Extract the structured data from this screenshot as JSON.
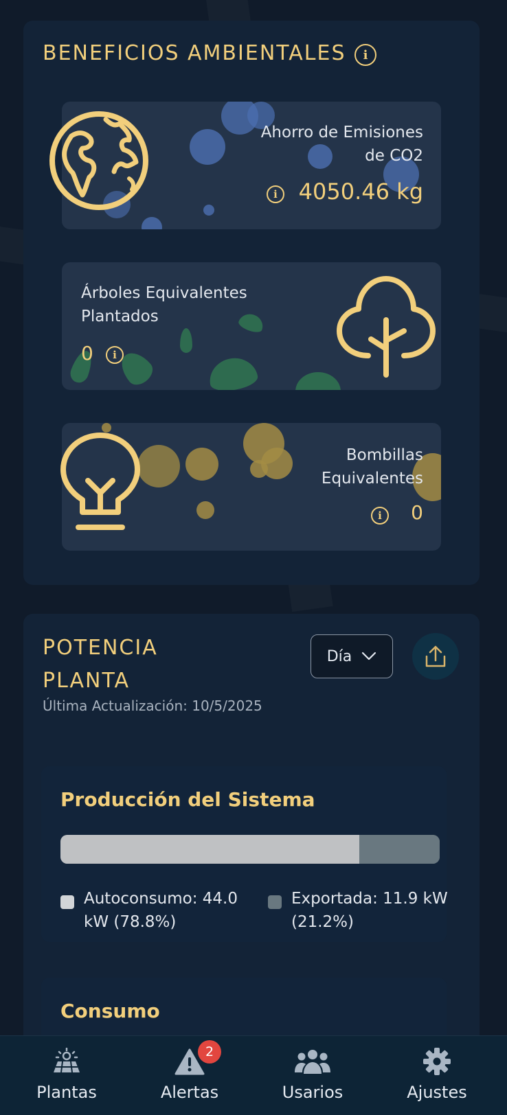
{
  "environmental": {
    "title": "BENEFICIOS AMBIENTALES",
    "co2": {
      "label": "Ahorro de Emisiones de CO2",
      "value": "4050.46 kg"
    },
    "trees": {
      "label": "Árboles Equivalentes Plantados",
      "value": "0"
    },
    "bulbs": {
      "label": "Bombillas Equivalentes",
      "value": "0"
    }
  },
  "power": {
    "title_line1": "POTENCIA",
    "title_line2": "PLANTA",
    "period": "Día",
    "last_update": "Última Actualización: 10/5/2025",
    "production": {
      "title": "Producción del Sistema",
      "self_consumption_fraction": 0.788,
      "self_consumption_label": "Autoconsumo: 44.0 kW (78.8%)",
      "exported_label": "Exportada: 11.9 kW (21.2%)"
    },
    "consumption_title": "Consumo"
  },
  "nav": {
    "items": [
      {
        "label": "Plantas",
        "icon": "solar-panel-icon"
      },
      {
        "label": "Alertas",
        "icon": "warning-icon",
        "badge": "2"
      },
      {
        "label": "Usarios",
        "icon": "users-icon"
      },
      {
        "label": "Ajustes",
        "icon": "gear-icon"
      }
    ]
  },
  "colors": {
    "accent": "#f2cf7c",
    "background": "#101b2a",
    "self_consumption_bar": "#bfc1c3",
    "exported_bar": "#697880",
    "badge": "#e2463f"
  }
}
